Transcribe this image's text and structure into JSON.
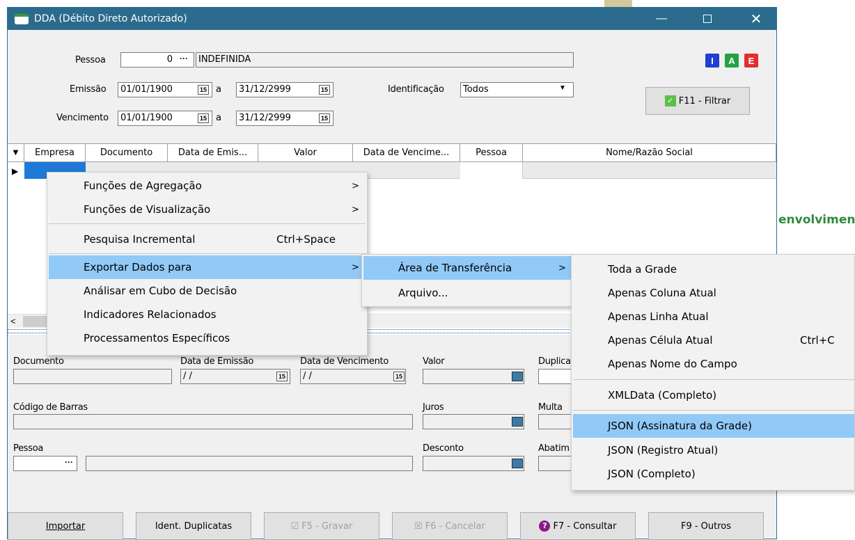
{
  "window": {
    "title": "DDA (Débito Direto Autorizado)"
  },
  "bg_text": "envolvimen",
  "filter": {
    "pessoa_label": "Pessoa",
    "pessoa_code": "0",
    "pessoa_name": "INDEFINIDA",
    "emissao_label": "Emissão",
    "emissao_from": "01/01/1900",
    "emissao_to": "31/12/2999",
    "vencimento_label": "Vencimento",
    "venc_from": "01/01/1900",
    "venc_to": "31/12/2999",
    "a_label": "a",
    "identificacao_label": "Identificação",
    "identificacao_value": "Todos",
    "filter_button": "F11 - Filtrar",
    "cal_glyph": "15",
    "ellipsis": "···"
  },
  "toolbar_icons": [
    "I",
    "A",
    "E"
  ],
  "grid": {
    "columns": [
      "Empresa",
      "Documento",
      "Data de Emis...",
      "Valor",
      "Data de Vencime...",
      "Pessoa",
      "Nome/Razão Social"
    ]
  },
  "context_menu": {
    "items": [
      {
        "label": "Funções de Agregação",
        "arrow": ">"
      },
      {
        "label": "Funções de Visualização",
        "arrow": ">"
      },
      {
        "label": "Pesquisa Incremental",
        "shortcut": "Ctrl+Space"
      },
      {
        "label": "Exportar Dados para",
        "arrow": ">"
      },
      {
        "label": "Análisar em Cubo de Decisão"
      },
      {
        "label": "Indicadores Relacionados"
      },
      {
        "label": "Processamentos Específicos"
      }
    ]
  },
  "submenu1": {
    "items": [
      {
        "label": "Área de Transferência",
        "arrow": ">"
      },
      {
        "label": "Arquivo..."
      }
    ]
  },
  "submenu2": {
    "items": [
      {
        "label": "Toda a Grade"
      },
      {
        "label": "Apenas Coluna Atual"
      },
      {
        "label": "Apenas Linha Atual"
      },
      {
        "label": "Apenas Célula Atual",
        "shortcut": "Ctrl+C"
      },
      {
        "label": "Apenas Nome do Campo"
      },
      {
        "label": "XMLData (Completo)"
      },
      {
        "label": "JSON (Assinatura da Grade)"
      },
      {
        "label": "JSON (Registro Atual)"
      },
      {
        "label": "JSON (Completo)"
      }
    ]
  },
  "details": {
    "documento": "Documento",
    "data_emissao": "Data de Emissão",
    "data_vencimento": "Data de Vencimento",
    "valor": "Valor",
    "duplica": "Duplica",
    "codigo_barras": "Código de Barras",
    "juros": "Juros",
    "multa": "Multa",
    "pessoa": "Pessoa",
    "desconto": "Desconto",
    "abatim": "Abatim",
    "empty_date": "/ /"
  },
  "buttons": {
    "importar": "Importar",
    "ident_duplicatas": "Ident. Duplicatas",
    "gravar": "F5 - Gravar",
    "cancelar": "F6 - Cancelar",
    "consultar": "F7 - Consultar",
    "outros": "F9 - Outros",
    "help_glyph": "?"
  }
}
